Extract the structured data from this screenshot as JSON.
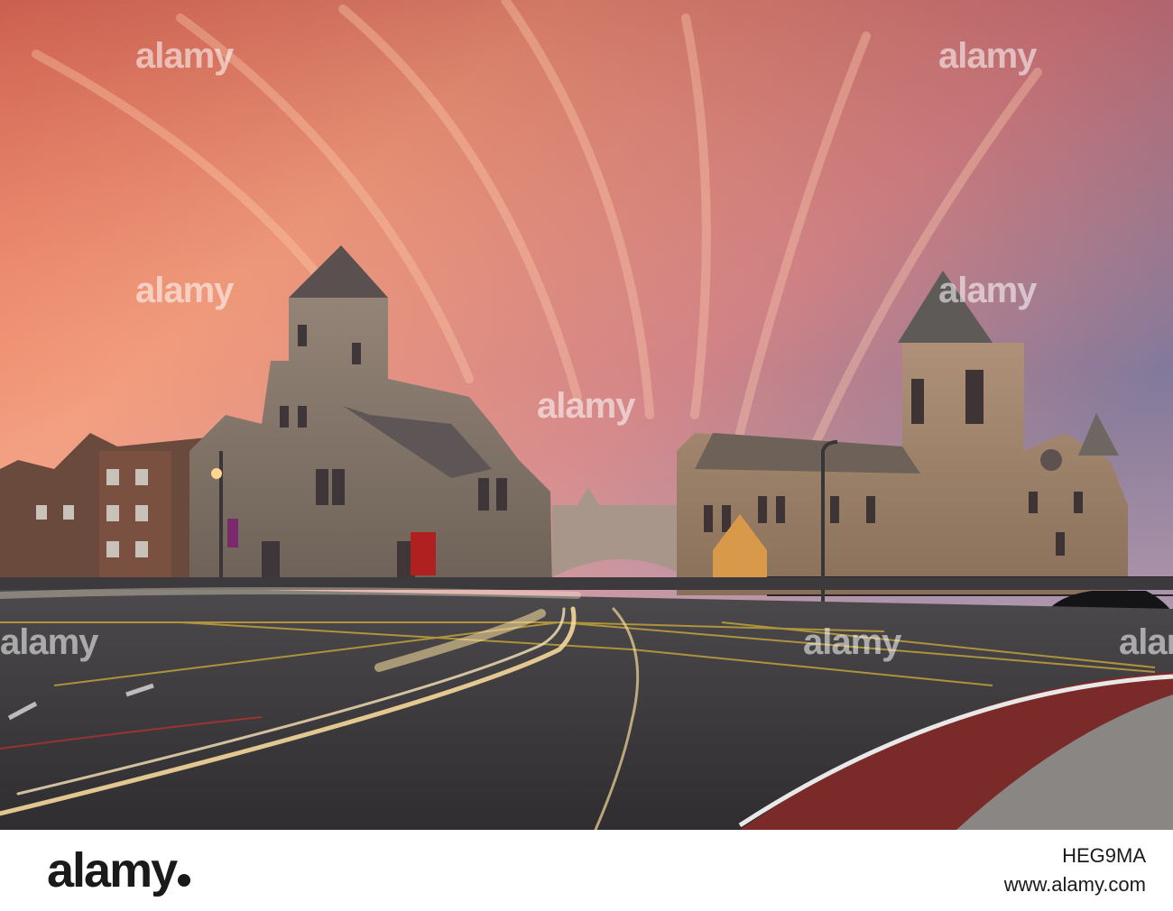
{
  "photo": {
    "scene": "Christ Church Cathedral and Dublinia synod hall at sunset with light trails on the road",
    "sky_colors": [
      "#f49a6e",
      "#e86a5c",
      "#b56a7a",
      "#6d6d99"
    ],
    "watermark_text": "alamy"
  },
  "footer": {
    "logo_text": "alamy",
    "image_id": "HEG9MA",
    "website": "www.alamy.com"
  }
}
